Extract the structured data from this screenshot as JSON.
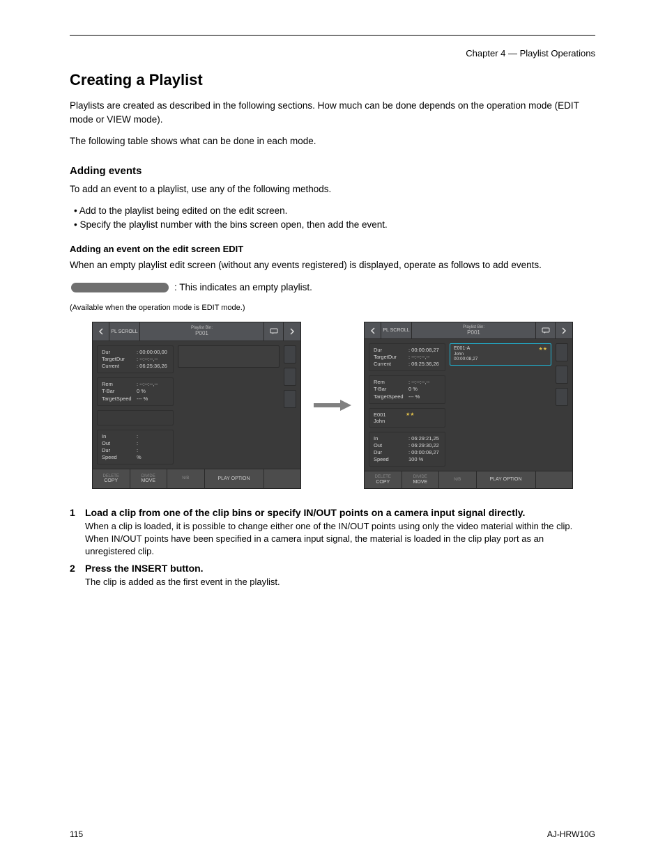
{
  "header": {
    "chapter_line": "Chapter 4 — Playlist Operations"
  },
  "title": "Creating a Playlist",
  "intro": [
    "Playlists are created as described in the following sections. How much can be done depends on the operation mode (EDIT mode or VIEW mode).",
    "The following table shows what can be done in each mode."
  ],
  "subhead1": "Adding events",
  "add_para": "To add an event to a playlist, use any of the following methods.",
  "methods": [
    "Add to the playlist being edited on the edit screen.",
    "Specify the playlist number with the bins screen open, then add the event."
  ],
  "add_on_edit_title": "Adding an event on the edit screen EDIT",
  "add_on_edit_intro": "When an empty playlist edit screen (without any events registered) is displayed, operate as follows to add events.",
  "pill_note": ": This indicates an empty playlist.",
  "avail_note": "(Available when the operation mode is EDIT mode.)",
  "screens": {
    "left": {
      "top": {
        "pl_scroll": "PL SCROLL",
        "title_1": "Playlist Bin:",
        "title_2": "P001"
      },
      "stats": [
        {
          "k": "Dur",
          "v": ": 00:00:00,00"
        },
        {
          "k": "TargetDur",
          "v": ": --:--:--,--"
        },
        {
          "k": "Current",
          "v": ": 06:25:36,26"
        }
      ],
      "stats2": [
        {
          "k": "Rem",
          "v": ": --:--:--,--"
        },
        {
          "k": "T-Bar",
          "v": "      0  %"
        },
        {
          "k": "TargetSpeed",
          "v": "     ---  %"
        }
      ],
      "io": [
        {
          "k": "In",
          "v": ":"
        },
        {
          "k": "Out",
          "v": ":"
        },
        {
          "k": "Dur",
          "v": ":"
        },
        {
          "k": "Speed",
          "v": "       %"
        }
      ],
      "bottom": [
        {
          "dim": "DELETE",
          "main": "COPY"
        },
        {
          "dim": "DIVIDE",
          "main": "MOVE"
        },
        {
          "dim": "N/B",
          "main": ""
        },
        {
          "dim": "",
          "main": "PLAY OPTION"
        },
        {
          "dim": "",
          "main": ""
        }
      ]
    },
    "right": {
      "top": {
        "pl_scroll": "PL SCROLL",
        "title_1": "Playlist Bin:",
        "title_2": "P001"
      },
      "stats": [
        {
          "k": "Dur",
          "v": ": 00:00:08,27"
        },
        {
          "k": "TargetDur",
          "v": ": --:--:--,--"
        },
        {
          "k": "Current",
          "v": ": 06:25:36,26"
        }
      ],
      "stats2": [
        {
          "k": "Rem",
          "v": ": --:--:--,--"
        },
        {
          "k": "T-Bar",
          "v": "      0  %"
        },
        {
          "k": "TargetSpeed",
          "v": "     ---  %"
        }
      ],
      "ev_left": {
        "id": "E001",
        "name": "John"
      },
      "io": [
        {
          "k": "In",
          "v": ": 06:29:21,25"
        },
        {
          "k": "Out",
          "v": ": 06:29:30,22"
        },
        {
          "k": "Dur",
          "v": ": 00:00:08,27"
        },
        {
          "k": "Speed",
          "v": "   100  %"
        }
      ],
      "event_card": {
        "id": "E001-A",
        "name": "John",
        "dur": "00:00:08,27"
      },
      "bottom": [
        {
          "dim": "DELETE",
          "main": "COPY"
        },
        {
          "dim": "DIVIDE",
          "main": "MOVE"
        },
        {
          "dim": "N/B",
          "main": ""
        },
        {
          "dim": "",
          "main": "PLAY OPTION"
        },
        {
          "dim": "",
          "main": ""
        }
      ]
    }
  },
  "steps": [
    {
      "no": "1",
      "title": "Load a clip from one of the clip bins or specify IN/OUT points on a camera input signal directly.",
      "body": "When a clip is loaded, it is possible to change either one of the IN/OUT points using only the video material within the clip.\nWhen IN/OUT points have been specified in a camera input signal, the material is loaded in the clip play port as an unregistered clip."
    },
    {
      "no": "2",
      "title": "Press the INSERT button.",
      "body": "The clip is added as the first event in the playlist."
    }
  ],
  "footer": {
    "page": "115",
    "right": "AJ-HRW10G"
  }
}
